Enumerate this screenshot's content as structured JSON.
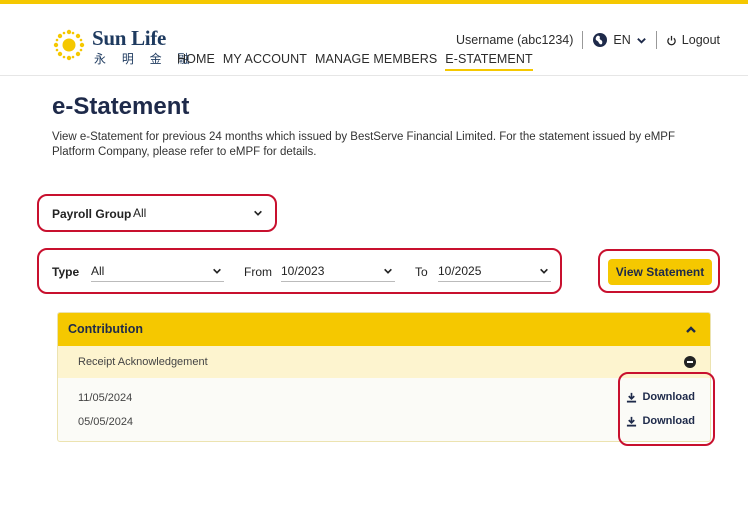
{
  "header": {
    "brand": "Sun Life",
    "brand_chinese": "永 明 金 融",
    "nav": [
      {
        "label": "HOME"
      },
      {
        "label": "MY ACCOUNT"
      },
      {
        "label": "MANAGE MEMBERS"
      },
      {
        "label": "E-STATEMENT",
        "active": true
      }
    ],
    "username": "Username (abc1234)",
    "language": "EN",
    "logout": "Logout"
  },
  "page": {
    "title": "e-Statement",
    "description": "View e-Statement for previous 24 months which issued by BestServe Financial Limited. For the statement issued by eMPF Platform Company, please refer to eMPF for details."
  },
  "filters": {
    "payroll_group_label": "Payroll Group",
    "payroll_group_value": "All",
    "type_label": "Type",
    "type_value": "All",
    "from_label": "From",
    "from_value": "10/2023",
    "to_label": "To",
    "to_value": "10/2025",
    "view_button": "View Statement"
  },
  "results": {
    "section_title": "Contribution",
    "subsection_title": "Receipt Acknowledgement",
    "rows": [
      {
        "date": "11/05/2024",
        "action": "Download"
      },
      {
        "date": "05/05/2024",
        "action": "Download"
      }
    ]
  },
  "colors": {
    "accent": "#f5c800",
    "highlight_border": "#c8102e",
    "brand_navy": "#1e3a5f"
  },
  "icons": [
    "sun-logo-icon",
    "globe-icon",
    "chevron-down-icon",
    "power-icon",
    "chevron-up-icon",
    "minus-circle-icon",
    "download-icon"
  ]
}
